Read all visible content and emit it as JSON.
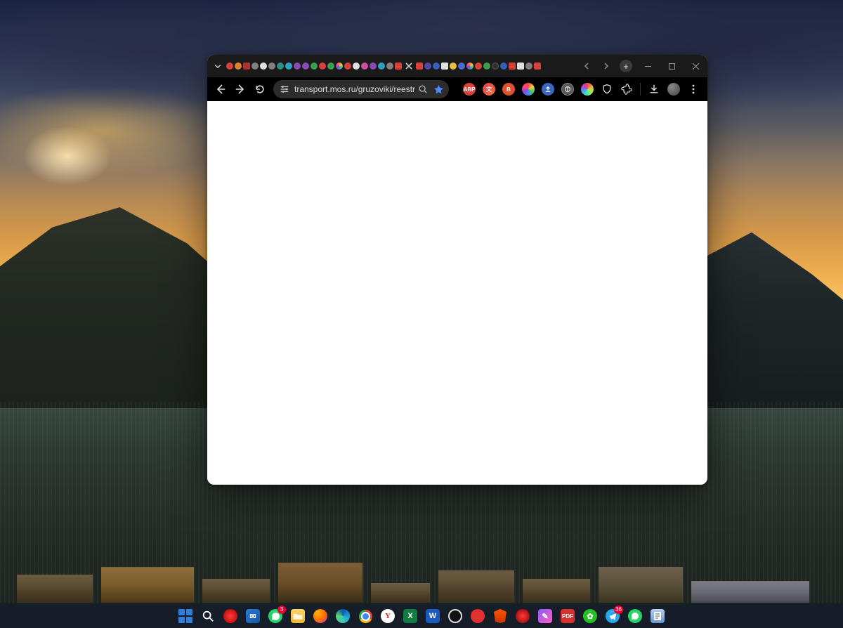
{
  "browser": {
    "url": "transport.mos.ru/gruzoviki/reestr",
    "tab_close_tooltip": "Close",
    "newtab_tooltip": "New tab",
    "tab_prev_tooltip": "Previous tab",
    "tab_next_tooltip": "Next tab",
    "search_tabs_tooltip": "Search tabs",
    "nav": {
      "back": "Back",
      "forward": "Forward",
      "reload": "Reload"
    },
    "omnibox": {
      "site_info_tooltip": "View site information",
      "zoom_tooltip": "Zoom",
      "bookmark_tooltip": "Bookmark this tab"
    },
    "extensions": {
      "abp": "ABP",
      "translate": "Translate",
      "bitwarden": "B",
      "assistant": "Assistant",
      "sharing": "Share",
      "grayscale": "Grayscale",
      "color": "Color picker",
      "shield": "Privacy",
      "puzzle": "Extensions",
      "downloads": "Downloads",
      "profile": "Profile",
      "menu": "Menu"
    },
    "window": {
      "minimize": "Minimize",
      "maximize": "Maximize",
      "close": "Close"
    }
  },
  "taskbar": {
    "start": "Start",
    "search": "Search",
    "whatsapp_badge": "3",
    "telegram_badge": "36"
  }
}
